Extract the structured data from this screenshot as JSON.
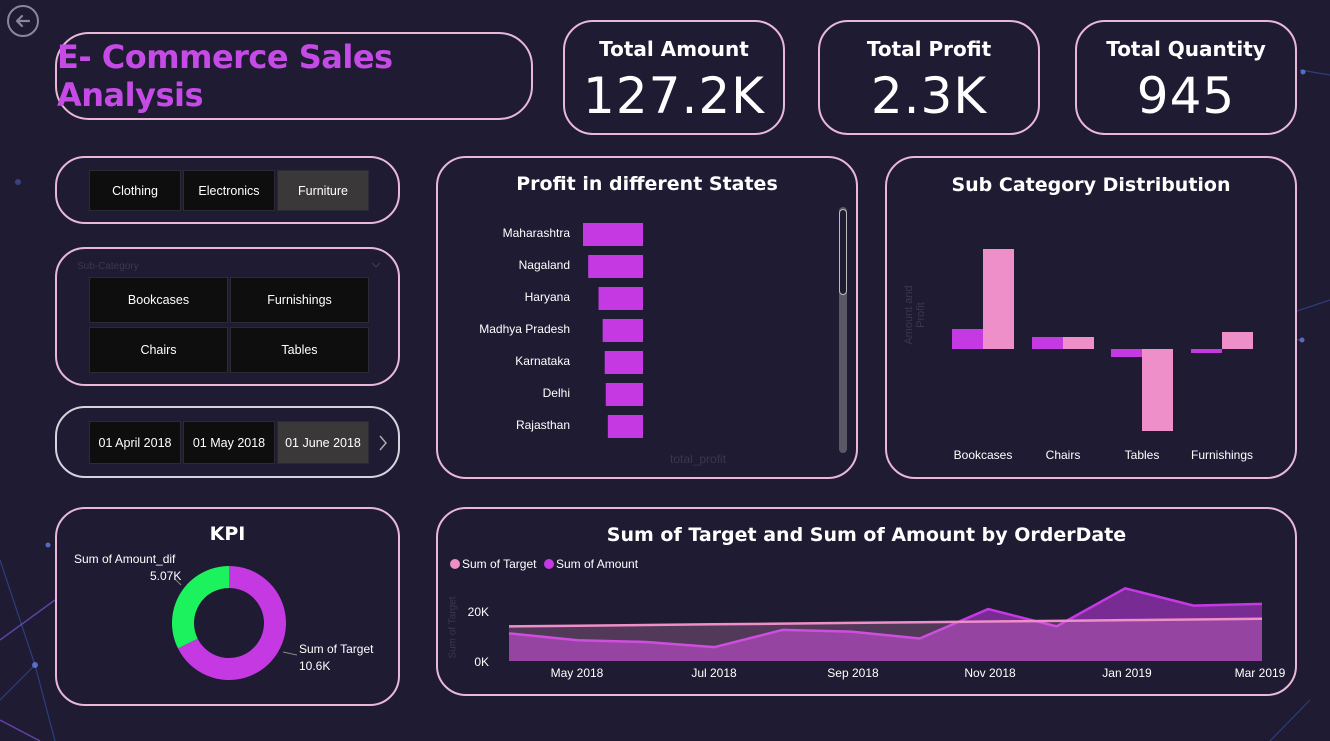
{
  "title": "E- Commerce Sales Analysis",
  "kpis": [
    {
      "label": "Total Amount",
      "value": "127.2K"
    },
    {
      "label": "Total Profit",
      "value": "2.3K"
    },
    {
      "label": "Total Quantity",
      "value": "945"
    }
  ],
  "category_slicer": {
    "items": [
      "Clothing",
      "Electronics",
      "Furniture"
    ],
    "selected": "Furniture"
  },
  "subcategory_slicer": {
    "header": "Sub-Category",
    "items": [
      "Bookcases",
      "Furnishings",
      "Chairs",
      "Tables"
    ]
  },
  "date_slicer": {
    "items": [
      "01 April 2018",
      "01 May 2018",
      "01 June 2018"
    ],
    "selected": "01 June 2018"
  },
  "colors": {
    "accent": "#c539e3",
    "pink": "#ee8fca",
    "green": "#1cf25e",
    "border": "#e9b8d9"
  },
  "charts": [
    {
      "type": "bar",
      "title": "Profit in different States",
      "xlabel": "total_profit",
      "categories": [
        "Maharashtra",
        "Nagaland",
        "Haryana",
        "Madhya Pradesh",
        "Karnataka",
        "Delhi",
        "Rajasthan"
      ],
      "values": [
        58,
        53,
        43,
        39,
        37,
        36,
        34
      ]
    },
    {
      "type": "bar",
      "title": "Sub Category Distribution",
      "ylabel": "Amount and Profit",
      "categories": [
        "Bookcases",
        "Chairs",
        "Tables",
        "Furnishings"
      ],
      "series": [
        {
          "color": "#c539e3",
          "values": [
            20,
            12,
            -8,
            -4
          ]
        },
        {
          "color": "#ee8fca",
          "values": [
            100,
            12,
            -82,
            17
          ]
        }
      ]
    },
    {
      "type": "pie",
      "title": "KPI",
      "slices": [
        {
          "label": "Sum of Amount_dif",
          "value_label": "5.07K",
          "value": 5.07,
          "color": "#1cf25e"
        },
        {
          "label": "Sum of Target",
          "value_label": "10.6K",
          "value": 10.6,
          "color": "#c539e3"
        }
      ]
    },
    {
      "type": "area",
      "title": "Sum of Target and Sum of Amount by OrderDate",
      "ylabel": "Sum of Target",
      "y_ticks": [
        "20K",
        "0K"
      ],
      "ylim": [
        0,
        30000
      ],
      "x_ticks": [
        "May 2018",
        "Jul 2018",
        "Sep 2018",
        "Nov 2018",
        "Jan 2019",
        "Mar 2019"
      ],
      "series": [
        {
          "name": "Sum of Target",
          "color": "#ee8fca",
          "values": [
            10000,
            10200,
            10400,
            10600,
            10800,
            11000,
            11200,
            11400,
            11600,
            11800,
            12000,
            12200
          ]
        },
        {
          "name": "Sum of Amount",
          "color": "#c539e3",
          "values": [
            8000,
            6000,
            5500,
            4000,
            9000,
            8500,
            6500,
            15000,
            10000,
            21000,
            16000,
            16500
          ]
        }
      ]
    }
  ]
}
